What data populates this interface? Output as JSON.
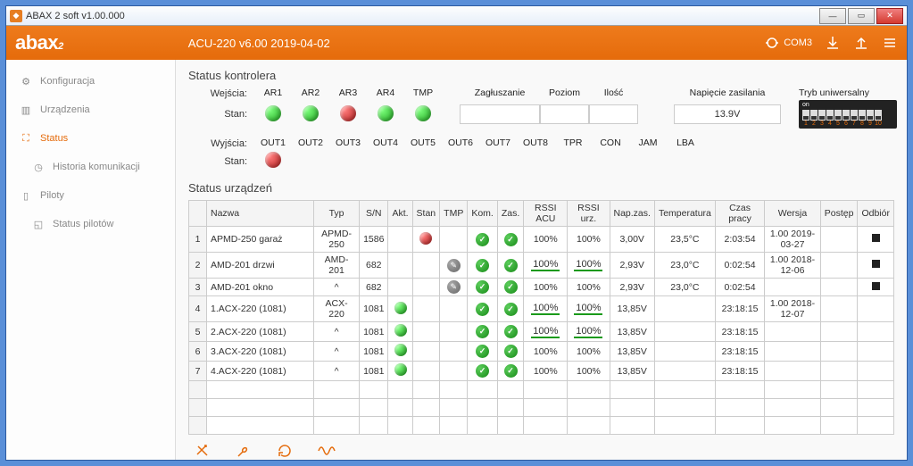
{
  "window_title": "ABAX 2 soft v1.00.000",
  "device_info": "ACU-220 v6.00 2019-04-02",
  "com_port": "COM3",
  "sidebar": {
    "items": [
      {
        "label": "Konfiguracja",
        "icon": "gear-icon"
      },
      {
        "label": "Urządzenia",
        "icon": "devices-icon"
      },
      {
        "label": "Status",
        "icon": "status-icon"
      },
      {
        "label": "Historia komunikacji",
        "icon": "history-icon",
        "sub": true
      },
      {
        "label": "Piloty",
        "icon": "remote-icon"
      },
      {
        "label": "Status pilotów",
        "icon": "remote-status-icon",
        "sub": true
      }
    ]
  },
  "controller": {
    "title": "Status kontrolera",
    "inputs_label": "Wejścia:",
    "outputs_label": "Wyjścia:",
    "state_label": "Stan:",
    "input_names": [
      "AR1",
      "AR2",
      "AR3",
      "AR4",
      "TMP"
    ],
    "input_states": [
      "green",
      "green",
      "red",
      "green",
      "green"
    ],
    "output_names": [
      "OUT1",
      "OUT2",
      "OUT3",
      "OUT4",
      "OUT5",
      "OUT6",
      "OUT7",
      "OUT8",
      "TPR",
      "CON",
      "JAM",
      "LBA"
    ],
    "output_states": [
      "red",
      "",
      "",
      "",
      "",
      "",
      "",
      "",
      "",
      "",
      "",
      ""
    ],
    "jam_label": "Zagłuszanie",
    "level_label": "Poziom",
    "count_label": "Ilość",
    "voltage_label": "Napięcie zasilania",
    "voltage_value": "13.9V",
    "mode_label": "Tryb uniwersalny",
    "dip_label": "on",
    "dip_numbers": [
      "1",
      "2",
      "3",
      "4",
      "5",
      "6",
      "7",
      "8",
      "9",
      "10"
    ]
  },
  "devices": {
    "title": "Status urządzeń",
    "headers": [
      "",
      "Nazwa",
      "Typ",
      "S/N",
      "Akt.",
      "Stan",
      "TMP",
      "Kom.",
      "Zas.",
      "RSSI ACU",
      "RSSI urz.",
      "Nap.zas.",
      "Temperatura",
      "Czas pracy",
      "Wersja",
      "Postęp",
      "Odbiór"
    ],
    "rows": [
      {
        "n": "1",
        "name": "APMD-250 garaż",
        "type": "APMD-250",
        "sn": "1586",
        "akt": "",
        "stan": "red",
        "tmp": "",
        "kom": "check",
        "zas": "check",
        "rssi_acu": "100%",
        "rssi_urz": "100%",
        "nap": "3,00V",
        "temp": "23,5°C",
        "czas": "2:03:54",
        "wersja": "1.00 2019-03-27",
        "postep": "",
        "odbior": "sq"
      },
      {
        "n": "2",
        "name": "AMD-201 drzwi",
        "type": "AMD-201",
        "sn": "682",
        "akt": "",
        "stan": "",
        "tmp": "gray",
        "kom": "check",
        "zas": "check",
        "rssi_acu": "100%",
        "rssi_urz": "100%",
        "nap": "2,93V",
        "temp": "23,0°C",
        "czas": "0:02:54",
        "wersja": "1.00 2018-12-06",
        "postep": "",
        "odbior": "sq",
        "ul": true
      },
      {
        "n": "3",
        "name": "AMD-201 okno",
        "type": "^",
        "sn": "682",
        "akt": "",
        "stan": "",
        "tmp": "gray",
        "kom": "check",
        "zas": "check",
        "rssi_acu": "100%",
        "rssi_urz": "100%",
        "nap": "2,93V",
        "temp": "23,0°C",
        "czas": "0:02:54",
        "wersja": "",
        "postep": "",
        "odbior": "sq"
      },
      {
        "n": "4",
        "name": "1.ACX-220 (1081)",
        "type": "ACX-220",
        "sn": "1081",
        "akt": "green",
        "stan": "",
        "tmp": "",
        "kom": "check",
        "zas": "check",
        "rssi_acu": "100%",
        "rssi_urz": "100%",
        "nap": "13,85V",
        "temp": "",
        "czas": "23:18:15",
        "wersja": "1.00 2018-12-07",
        "postep": "",
        "odbior": "",
        "ul": true
      },
      {
        "n": "5",
        "name": "2.ACX-220 (1081)",
        "type": "^",
        "sn": "1081",
        "akt": "green",
        "stan": "",
        "tmp": "",
        "kom": "check",
        "zas": "check",
        "rssi_acu": "100%",
        "rssi_urz": "100%",
        "nap": "13,85V",
        "temp": "",
        "czas": "23:18:15",
        "wersja": "",
        "postep": "",
        "odbior": "",
        "ul": true
      },
      {
        "n": "6",
        "name": "3.ACX-220 (1081)",
        "type": "^",
        "sn": "1081",
        "akt": "green",
        "stan": "",
        "tmp": "",
        "kom": "check",
        "zas": "check",
        "rssi_acu": "100%",
        "rssi_urz": "100%",
        "nap": "13,85V",
        "temp": "",
        "czas": "23:18:15",
        "wersja": "",
        "postep": "",
        "odbior": ""
      },
      {
        "n": "7",
        "name": "4.ACX-220 (1081)",
        "type": "^",
        "sn": "1081",
        "akt": "green",
        "stan": "",
        "tmp": "",
        "kom": "check",
        "zas": "check",
        "rssi_acu": "100%",
        "rssi_urz": "100%",
        "nap": "13,85V",
        "temp": "",
        "czas": "23:18:15",
        "wersja": "",
        "postep": "",
        "odbior": ""
      }
    ]
  }
}
